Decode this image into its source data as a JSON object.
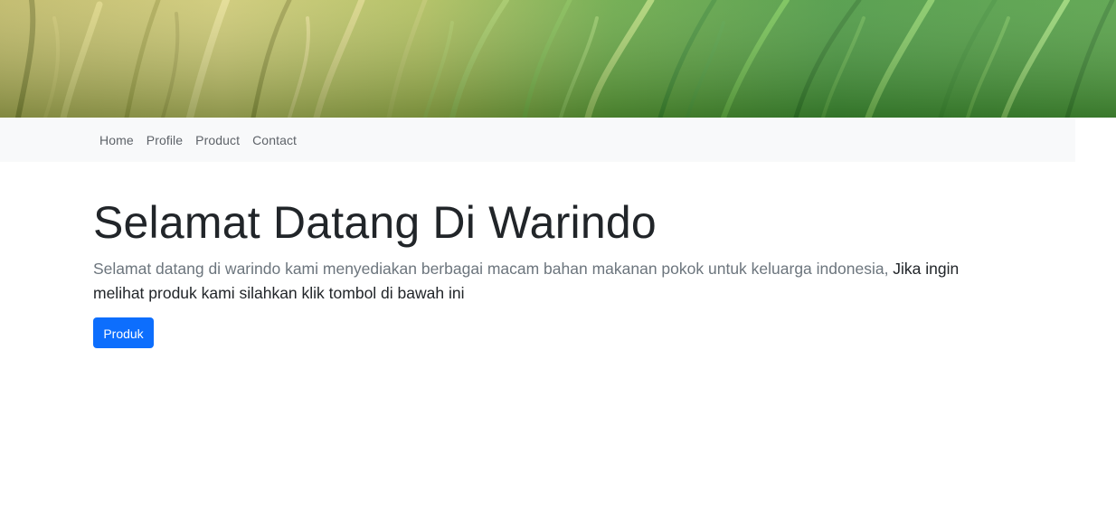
{
  "banner": {
    "alt": "rice field banner"
  },
  "nav": {
    "items": [
      {
        "label": "Home"
      },
      {
        "label": "Profile"
      },
      {
        "label": "Product"
      },
      {
        "label": "Contact"
      }
    ]
  },
  "hero": {
    "title": "Selamat Datang Di Warindo",
    "text_light": "Selamat datang di warindo kami menyediakan berbagai macam bahan makanan pokok untuk keluarga indonesia, ",
    "text_strong": "Jika ingin melihat produk kami silahkan klik tombol di bawah ini",
    "button_label": "Produk"
  },
  "colors": {
    "primary_button": "#0d6efd",
    "navbar_bg": "#f8f9fa",
    "heading": "#212529",
    "muted_text": "#6c757d"
  }
}
